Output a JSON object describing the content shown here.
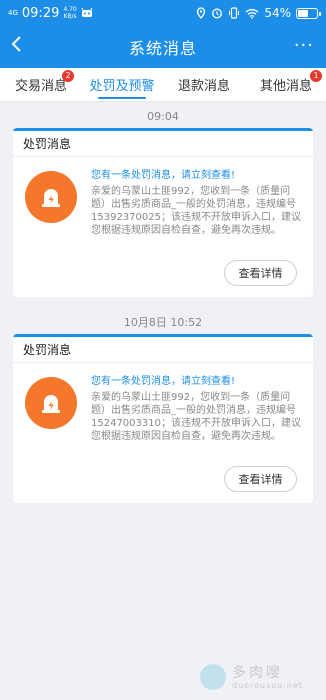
{
  "status_bar": {
    "signal": "4G",
    "time": "09:29",
    "speed_value": "4.70",
    "speed_unit": "KB/s",
    "battery": "54%"
  },
  "app_bar": {
    "title": "系统消息",
    "more": "···"
  },
  "tabs": [
    {
      "label": "交易消息",
      "badge": "2"
    },
    {
      "label": "处罚及预警",
      "badge": ""
    },
    {
      "label": "退款消息",
      "badge": ""
    },
    {
      "label": "其他消息",
      "badge": "1"
    }
  ],
  "messages": [
    {
      "time": "09:04",
      "header": "处罚消息",
      "title": "您有一条处罚消息，请立刻查看!",
      "body": "亲爱的乌蒙山土匪992，您收到一条（质量问题）出售劣质商品_一般的处罚消息，违规编号15392370025；该违规不开放申诉入口，建议您根据违规原因自检自查，避免再次违规。",
      "button": "查看详情"
    },
    {
      "time": "10月8日 10:52",
      "header": "处罚消息",
      "title": "您有一条处罚消息，请立刻查看!",
      "body": "亲爱的乌蒙山土匪992，您收到一条（质量问题）出售劣质商品_一般的处罚消息，违规编号15247003310；该违规不开放申诉入口，建议您根据违规原因自检自查，避免再次违规。",
      "button": "查看详情"
    }
  ],
  "watermark": {
    "text": "多肉嗖",
    "url": "duorousou.net"
  },
  "colors": {
    "accent": "#1d8ee8",
    "badge": "#e8372d",
    "icon_bg": "#f4772b"
  }
}
